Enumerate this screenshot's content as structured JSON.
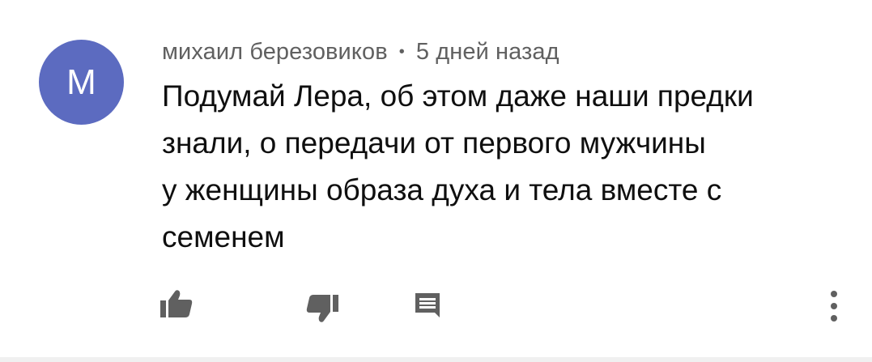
{
  "comment": {
    "avatar_letter": "M",
    "avatar_color": "#5c6bc0",
    "author": "михаил березовиков",
    "separator": "•",
    "time": "5 дней назад",
    "text_lines": [
      "Подумай Лера, об этом даже наши предки",
      "знали, о передачи от первого мужчины",
      "у женщины образа духа и тела вместе с",
      "семенем"
    ]
  },
  "actions": {
    "like_icon": "thumb-up-icon",
    "dislike_icon": "thumb-down-icon",
    "reply_icon": "comment-icon",
    "more_icon": "more-vertical-icon",
    "icon_color": "#606060"
  }
}
